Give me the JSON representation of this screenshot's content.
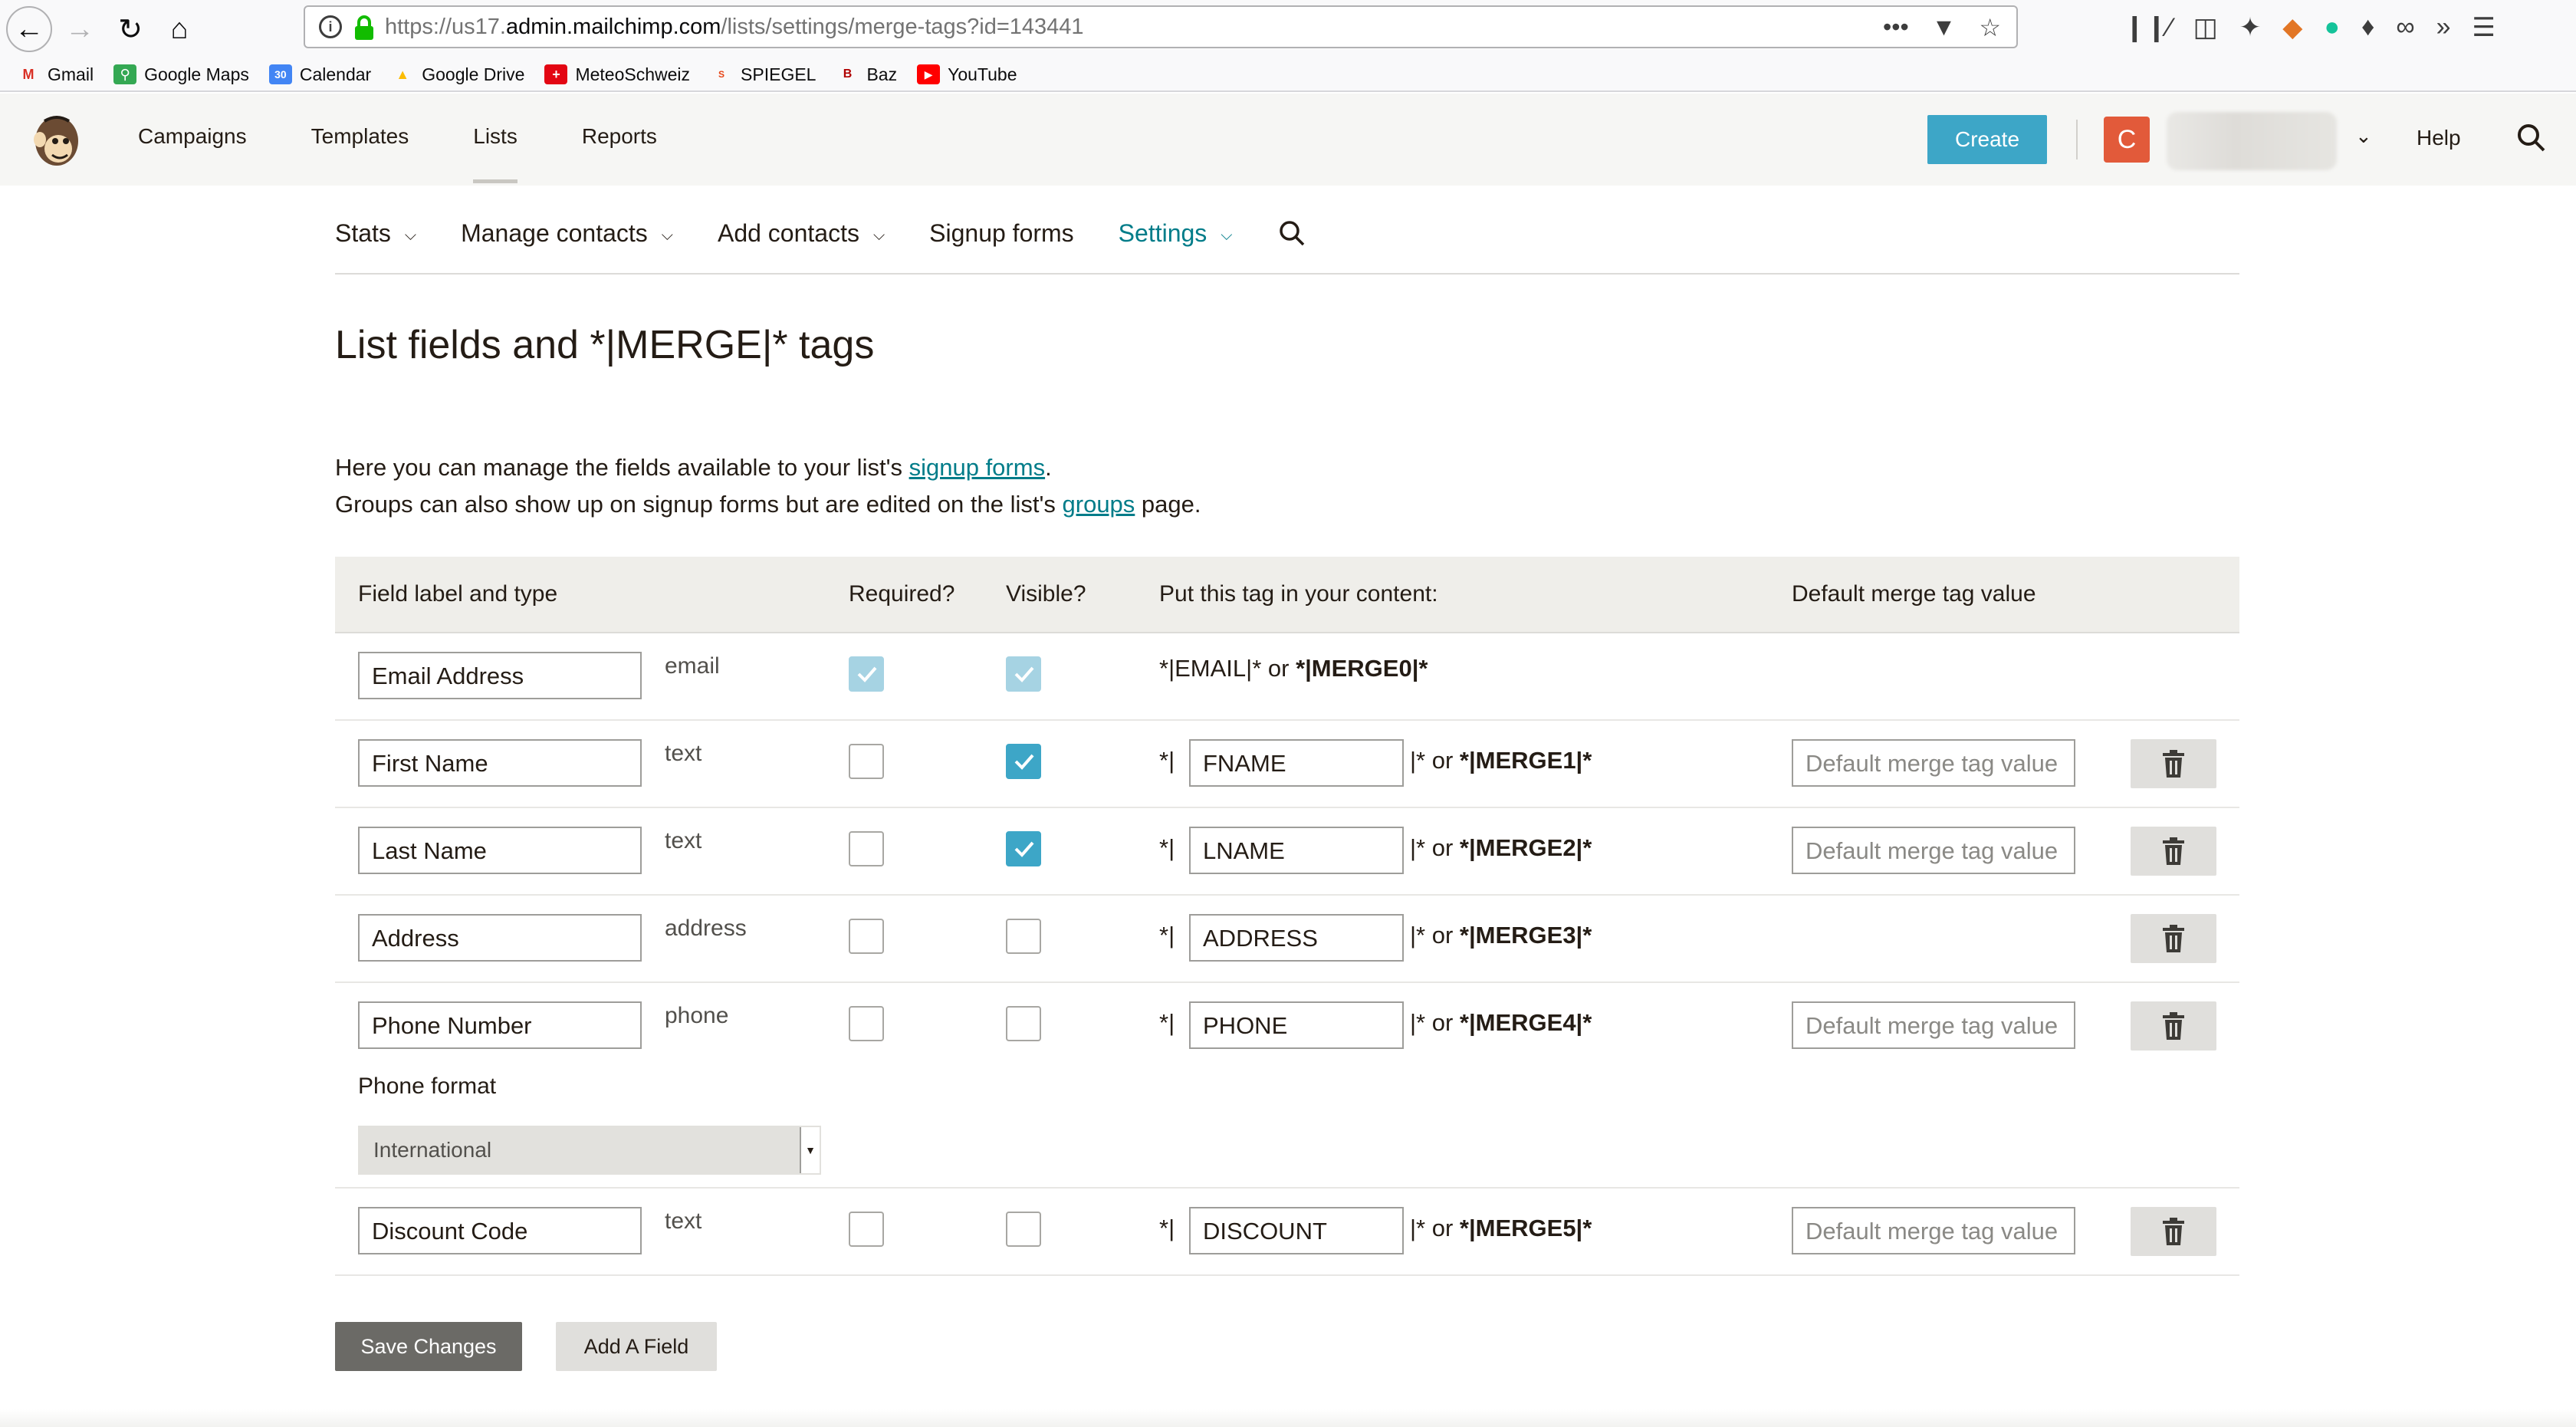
{
  "browser": {
    "url_prefix": "https://us17.",
    "url_domain": "admin.mailchimp.com",
    "url_path": "/lists/settings/merge-tags?id=143441",
    "bookmarks": [
      {
        "label": "Gmail",
        "icon": "gmail-icon",
        "color": "#d93025"
      },
      {
        "label": "Google Maps",
        "icon": "google-maps-icon",
        "color": "#34a853"
      },
      {
        "label": "Calendar",
        "icon": "calendar-icon",
        "color": "#4285f4"
      },
      {
        "label": "Google Drive",
        "icon": "google-drive-icon",
        "color": "#fbbc04"
      },
      {
        "label": "MeteoSchweiz",
        "icon": "swiss-cross-icon",
        "color": "#e30613"
      },
      {
        "label": "SPIEGEL",
        "icon": "spiegel-icon",
        "color": "#e64415"
      },
      {
        "label": "Baz",
        "icon": "baz-icon",
        "color": "#b00000"
      },
      {
        "label": "YouTube",
        "icon": "youtube-icon",
        "color": "#ff0000"
      }
    ]
  },
  "header": {
    "nav": [
      "Campaigns",
      "Templates",
      "Lists",
      "Reports"
    ],
    "active_nav": "Lists",
    "create_label": "Create",
    "avatar_letter": "C",
    "help_label": "Help",
    "accent_color": "#3da6c7"
  },
  "subnav": {
    "items": [
      "Stats",
      "Manage contacts",
      "Add contacts",
      "Signup forms",
      "Settings"
    ],
    "selected": "Settings"
  },
  "page": {
    "title": "List fields and *|MERGE|* tags",
    "intro_1a": "Here you can manage the fields available to your list's ",
    "intro_1_link": "signup forms",
    "intro_1b": ".",
    "intro_2a": "Groups can also show up on signup forms but are edited on the list's ",
    "intro_2_link": "groups",
    "intro_2b": " page."
  },
  "table": {
    "headers": {
      "label": "Field label and type",
      "required": "Required?",
      "visible": "Visible?",
      "tag": "Put this tag in your content:",
      "default": "Default merge tag value"
    },
    "default_placeholder": "Default merge tag value",
    "rows": [
      {
        "label": "Email Address",
        "type": "email",
        "required": true,
        "visible": true,
        "tag_text": "*|EMAIL|* or ",
        "merge": "*|MERGE0|*"
      },
      {
        "label": "First Name",
        "type": "text",
        "required": false,
        "visible": true,
        "tag": "FNAME",
        "merge": "*|MERGE1|*"
      },
      {
        "label": "Last Name",
        "type": "text",
        "required": false,
        "visible": true,
        "tag": "LNAME",
        "merge": "*|MERGE2|*"
      },
      {
        "label": "Address",
        "type": "address",
        "required": false,
        "visible": false,
        "tag": "ADDRESS",
        "merge": "*|MERGE3|*"
      },
      {
        "label": "Phone Number",
        "type": "phone",
        "required": false,
        "visible": false,
        "tag": "PHONE",
        "merge": "*|MERGE4|*",
        "format_label": "Phone format",
        "format_value": "International"
      },
      {
        "label": "Discount Code",
        "type": "text",
        "required": false,
        "visible": false,
        "tag": "DISCOUNT",
        "merge": "*|MERGE5|*"
      }
    ],
    "tag_prefix": "*|",
    "tag_suffix": "|* or "
  },
  "footer": {
    "save_label": "Save Changes",
    "add_label": "Add A Field"
  }
}
